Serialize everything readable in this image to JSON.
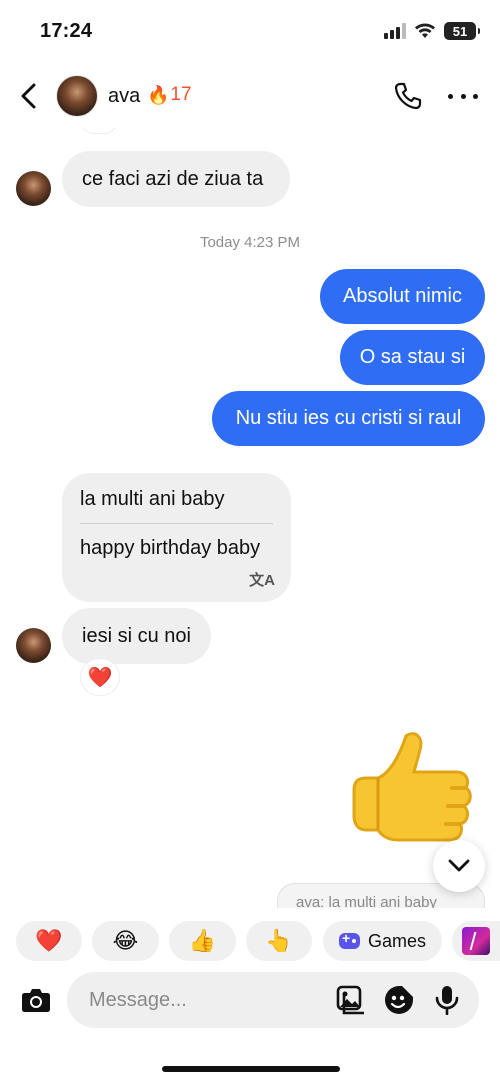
{
  "status_bar": {
    "time": "17:24",
    "battery": "51"
  },
  "header": {
    "name": "ava",
    "streak_count": "17",
    "streak_icon": "fire-icon",
    "back_icon": "chevron-left-icon",
    "call_icon": "phone-icon",
    "more_icon": "more-horizontal-icon"
  },
  "messages": {
    "m1": "ce faci azi de ziua ta",
    "timestamp": "Today 4:23 PM",
    "out1": "Absolut nimic",
    "out2": "O sa stau si",
    "out3": "Nu stiu ies cu cristi si raul",
    "translated_original": "la multi ani baby",
    "translated_text": "happy birthday baby",
    "translate_icon": "文A",
    "m3": "iesi si cu noi",
    "m3_reaction": "❤️",
    "reply_preview": "ava: la multi ani baby"
  },
  "quick_reactions": {
    "r1": "❤️",
    "r2": "😂",
    "r3": "👍",
    "r4": "👆",
    "games_label": "Games"
  },
  "composer": {
    "placeholder": "Message..."
  },
  "colors": {
    "outgoing_bubble": "#2f6df5",
    "incoming_bubble": "#efefef",
    "streak": "#f0542c"
  }
}
